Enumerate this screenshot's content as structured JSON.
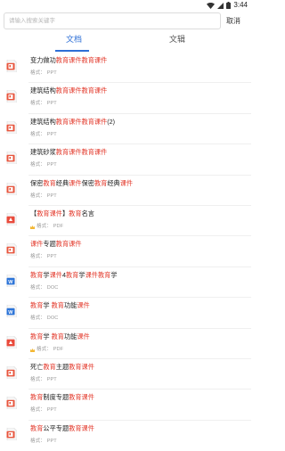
{
  "status_bar": {
    "time": "3:44"
  },
  "search": {
    "placeholder": "请输入搜索关键字",
    "cancel_label": "取消"
  },
  "tabs": [
    {
      "label": "文档",
      "active": true
    },
    {
      "label": "文辑",
      "active": false
    }
  ],
  "colors": {
    "accent": "#2d6fd6",
    "highlight": "#e33a2c",
    "ppt": "#e8553d",
    "pdf": "#e94b3c",
    "doc": "#2c74d8"
  },
  "results": [
    {
      "type": "ppt",
      "title_parts": [
        {
          "text": "变力做功",
          "hl": false
        },
        {
          "text": "教育课件教育课件",
          "hl": true
        }
      ],
      "meta_label": "格式：",
      "meta_value": "PPT",
      "crown": false
    },
    {
      "type": "ppt",
      "title_parts": [
        {
          "text": "建筑结构",
          "hl": false
        },
        {
          "text": "教育课件教育课件",
          "hl": true
        }
      ],
      "meta_label": "格式：",
      "meta_value": "PPT",
      "crown": false
    },
    {
      "type": "ppt",
      "title_parts": [
        {
          "text": "建筑结构",
          "hl": false
        },
        {
          "text": "教育课件教育课件",
          "hl": true
        },
        {
          "text": "(2)",
          "hl": false
        }
      ],
      "meta_label": "格式：",
      "meta_value": "PPT",
      "crown": false
    },
    {
      "type": "ppt",
      "title_parts": [
        {
          "text": "建筑砂浆",
          "hl": false
        },
        {
          "text": "教育课件教育课件",
          "hl": true
        }
      ],
      "meta_label": "格式：",
      "meta_value": "PPT",
      "crown": false
    },
    {
      "type": "ppt",
      "title_parts": [
        {
          "text": "保密",
          "hl": false
        },
        {
          "text": "教育",
          "hl": true
        },
        {
          "text": "经典",
          "hl": false
        },
        {
          "text": "课件",
          "hl": true
        },
        {
          "text": "保密",
          "hl": false
        },
        {
          "text": "教育",
          "hl": true
        },
        {
          "text": "经典",
          "hl": false
        },
        {
          "text": "课件",
          "hl": true
        }
      ],
      "meta_label": "格式：",
      "meta_value": "PPT",
      "crown": false
    },
    {
      "type": "pdf",
      "title_parts": [
        {
          "text": "【",
          "hl": false
        },
        {
          "text": "教育课件",
          "hl": true
        },
        {
          "text": "】",
          "hl": false
        },
        {
          "text": "教育",
          "hl": true
        },
        {
          "text": "名言",
          "hl": false
        }
      ],
      "meta_label": "格式：",
      "meta_value": "PDF",
      "crown": true
    },
    {
      "type": "ppt",
      "title_parts": [
        {
          "text": "课件",
          "hl": true
        },
        {
          "text": "专题",
          "hl": false
        },
        {
          "text": "教育课件",
          "hl": true
        }
      ],
      "meta_label": "格式：",
      "meta_value": "PPT",
      "crown": false
    },
    {
      "type": "doc",
      "title_parts": [
        {
          "text": "教育",
          "hl": true
        },
        {
          "text": "学",
          "hl": false
        },
        {
          "text": "课件",
          "hl": true
        },
        {
          "text": "4",
          "hl": false
        },
        {
          "text": "教育",
          "hl": true
        },
        {
          "text": "学",
          "hl": false
        },
        {
          "text": "课件",
          "hl": true
        },
        {
          "text": "教育",
          "hl": true
        },
        {
          "text": "学",
          "hl": false
        }
      ],
      "meta_label": "格式：",
      "meta_value": "DOC",
      "crown": false
    },
    {
      "type": "doc",
      "title_parts": [
        {
          "text": "教育",
          "hl": true
        },
        {
          "text": "学 ",
          "hl": false
        },
        {
          "text": "教育",
          "hl": true
        },
        {
          "text": "功能",
          "hl": false
        },
        {
          "text": "课件",
          "hl": true
        }
      ],
      "meta_label": "格式：",
      "meta_value": "DOC",
      "crown": false
    },
    {
      "type": "pdf",
      "title_parts": [
        {
          "text": "教育",
          "hl": true
        },
        {
          "text": "学 ",
          "hl": false
        },
        {
          "text": "教育",
          "hl": true
        },
        {
          "text": "功能",
          "hl": false
        },
        {
          "text": "课件",
          "hl": true
        }
      ],
      "meta_label": "格式：",
      "meta_value": "PDF",
      "crown": true
    },
    {
      "type": "ppt",
      "title_parts": [
        {
          "text": "死亡",
          "hl": false
        },
        {
          "text": "教育",
          "hl": true
        },
        {
          "text": "主题",
          "hl": false
        },
        {
          "text": "教育课件",
          "hl": true
        }
      ],
      "meta_label": "格式：",
      "meta_value": "PPT",
      "crown": false
    },
    {
      "type": "ppt",
      "title_parts": [
        {
          "text": "教育",
          "hl": true
        },
        {
          "text": "制度专题",
          "hl": false
        },
        {
          "text": "教育课件",
          "hl": true
        }
      ],
      "meta_label": "格式：",
      "meta_value": "PPT",
      "crown": false
    },
    {
      "type": "ppt",
      "title_parts": [
        {
          "text": "教育",
          "hl": true
        },
        {
          "text": "公平专题",
          "hl": false
        },
        {
          "text": "教育课件",
          "hl": true
        }
      ],
      "meta_label": "格式：",
      "meta_value": "PPT",
      "crown": false
    }
  ]
}
